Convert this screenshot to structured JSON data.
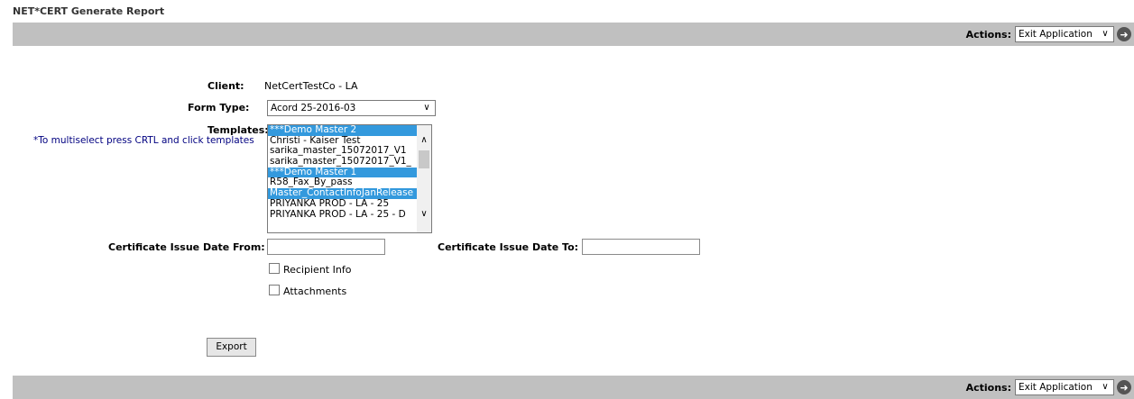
{
  "page_title": "NET*CERT Generate Report",
  "actions": {
    "label": "Actions:",
    "selected": "Exit Application"
  },
  "form": {
    "client_label": "Client:",
    "client_value": "NetCertTestCo - LA",
    "form_type_label": "Form Type:",
    "form_type_value": "Acord 25-2016-03",
    "templates_label": "Templates:",
    "templates_hint": "*To multiselect press CRTL and click templates",
    "templates": [
      {
        "label": "***Demo Master 2",
        "selected": true
      },
      {
        "label": "Christi - Kaiser Test",
        "selected": false
      },
      {
        "label": "sarika_master_15072017_V1",
        "selected": false
      },
      {
        "label": "sarika_master_15072017_V1_",
        "selected": false
      },
      {
        "label": "***Demo Master 1",
        "selected": true
      },
      {
        "label": "R58_Fax_By_pass",
        "selected": false
      },
      {
        "label": "Master_ContactInfoJanRelease",
        "selected": true
      },
      {
        "label": "PRIYANKA PROD - LA - 25",
        "selected": false
      },
      {
        "label": "PRIYANKA PROD - LA - 25 - D",
        "selected": false
      }
    ],
    "date_from_label": "Certificate Issue Date From:",
    "date_from_value": "",
    "date_to_label": "Certificate Issue Date To:",
    "date_to_value": "",
    "recipient_info_label": "Recipient Info",
    "attachments_label": "Attachments",
    "export_label": "Export"
  }
}
